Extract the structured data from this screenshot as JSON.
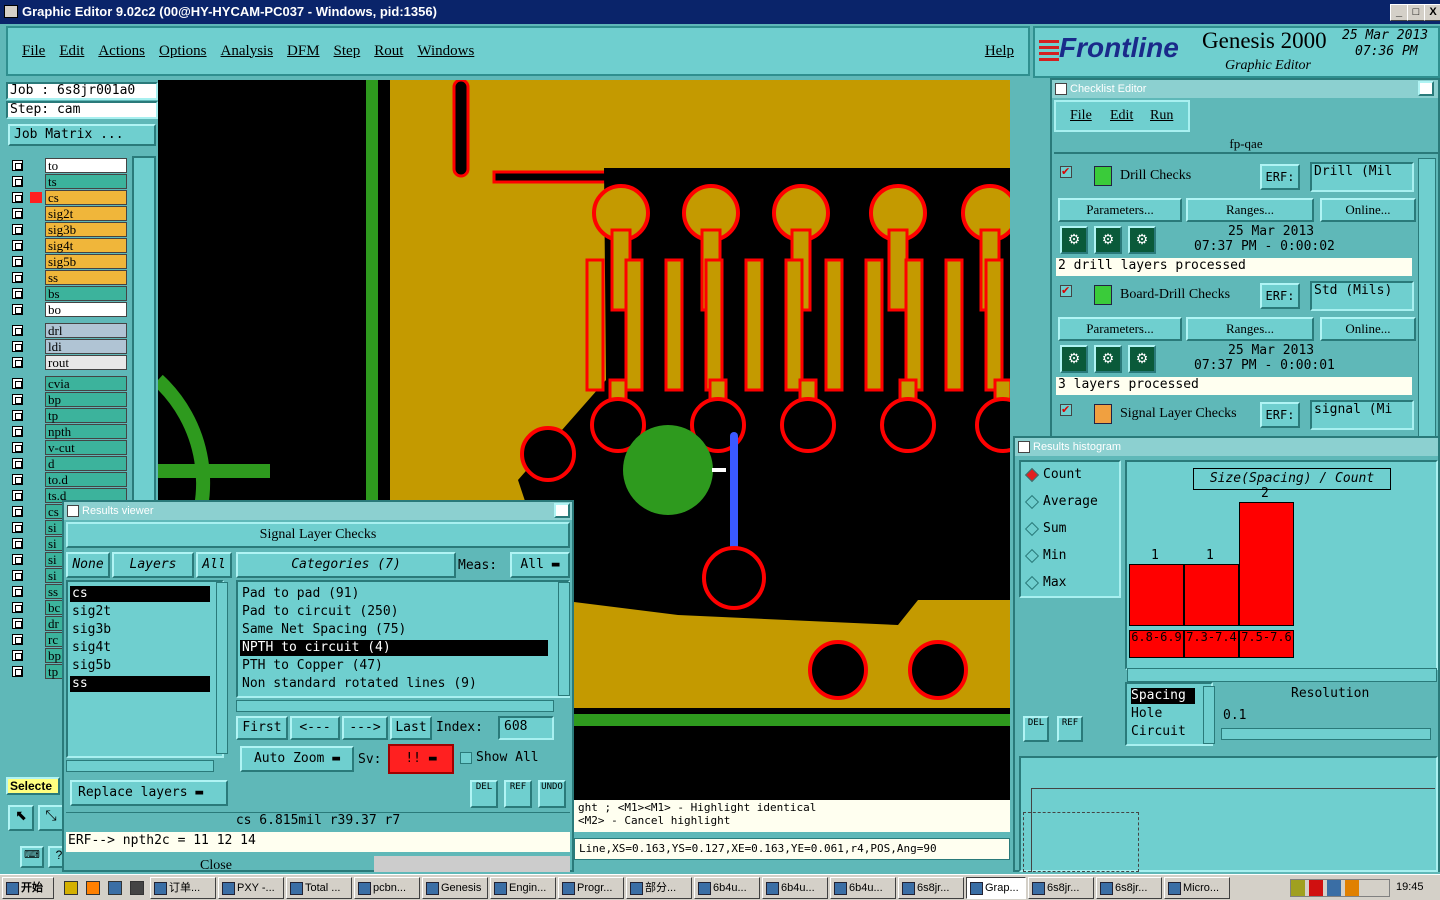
{
  "window": {
    "title": "Graphic Editor 9.02c2 (00@HY-HYCAM-PC037 - Windows, pid:1356)",
    "btns": [
      "_",
      "□",
      "X"
    ]
  },
  "menu": [
    "File",
    "Edit",
    "Actions",
    "Options",
    "Analysis",
    "DFM",
    "Step",
    "Rout",
    "Windows"
  ],
  "help": "Help",
  "brand": {
    "name": "Frontline",
    "product": "Genesis 2000",
    "sub": "Graphic Editor",
    "date": "25 Mar 2013",
    "time": "07:36 PM"
  },
  "job": {
    "job": "Job  :  6s8jr001a0",
    "step": "Step: cam",
    "matrix": "Job Matrix ..."
  },
  "layers_a": [
    "to",
    "ts",
    "cs",
    "sig2t",
    "sig3b",
    "sig4t",
    "sig5b",
    "ss",
    "bs",
    "bo"
  ],
  "layers_b": [
    "drl",
    "ldi",
    "rout"
  ],
  "layers_c": [
    "cvia",
    "bp",
    "tp",
    "npth",
    "v-cut",
    "d",
    "to.d",
    "ts.d",
    "cs",
    "si",
    "si",
    "si",
    "si",
    "ss",
    "bc",
    "dr",
    "rc",
    "bp",
    "tp"
  ],
  "select_label": "Selecte",
  "checklist": {
    "title": "Checklist Editor",
    "menu": [
      "File",
      "Edit",
      "Run"
    ],
    "name": "fp-qae",
    "checks": [
      {
        "name": "Drill Checks",
        "erf": "ERF:",
        "erfval": "Drill (Mil",
        "params": "Parameters...",
        "ranges": "Ranges...",
        "online": "Online...",
        "date": "25 Mar 2013",
        "time": "07:37 PM - 0:00:02",
        "status": "2 drill layers processed"
      },
      {
        "name": "Board-Drill Checks",
        "erf": "ERF:",
        "erfval": "Std (Mils)",
        "params": "Parameters...",
        "ranges": "Ranges...",
        "online": "Online...",
        "date": "25 Mar 2013",
        "time": "07:37 PM - 0:00:01",
        "status": "3 layers processed"
      },
      {
        "name": "Signal Layer Checks",
        "erf": "ERF:",
        "erfval": "signal (Mi"
      }
    ]
  },
  "histogram": {
    "title": "Results histogram",
    "modes": [
      "Count",
      "Average",
      "Sum",
      "Min",
      "Max"
    ],
    "chart_title": "Size(Spacing) / Count",
    "del": "DEL",
    "ref": "REF",
    "list": [
      "Spacing",
      "Hole",
      "Circuit"
    ],
    "resolution_label": "Resolution",
    "resolution": "0.1",
    "chart_data": {
      "type": "bar",
      "categories": [
        "6.8-6.9",
        "7.3-7.4",
        "7.5-7.6"
      ],
      "values": [
        1,
        1,
        2
      ],
      "title": "Size(Spacing) / Count"
    }
  },
  "results": {
    "title": "Results viewer",
    "heading": "Signal Layer Checks",
    "none": "None",
    "layers": "Layers",
    "all": "All",
    "categories_btn": "Categories (7)",
    "meas": "Meas:",
    "meas_val": "All",
    "layer_list": [
      "cs",
      "sig2t",
      "sig3b",
      "sig4t",
      "sig5b",
      "ss"
    ],
    "cat_list": [
      "Pad to pad (91)",
      "Pad to circuit (250)",
      "Same Net Spacing (75)",
      "NPTH to circuit (4)",
      "PTH to Copper (47)",
      "Non standard rotated lines (9)"
    ],
    "first": "First",
    "prev": "<---",
    "next": "--->",
    "last": "Last",
    "index_label": "Index:",
    "index_val": "608",
    "autozoom": "Auto Zoom",
    "sv": "Sv:",
    "sv_val": "!!",
    "showall": "Show All",
    "replace": "Replace layers",
    "del": "DEL",
    "ref": "REF",
    "undo": "UNDO",
    "info": "cs 6.815mil  r39.37  r7",
    "erf": "ERF--> npth2c = 11 12 14",
    "close": "Close"
  },
  "hint": {
    "l1": "ght ; <M1><M1> - Highlight identical",
    "l2": "<M2> - Cancel highlight"
  },
  "coords": "Line,XS=0.163,YS=0.127,XE=0.163,YE=0.061,r4,POS,Ang=90",
  "taskbar": {
    "start": "开始",
    "items": [
      "订单...",
      "PXY -...",
      "Total ...",
      "pcbn...",
      "Genesis",
      "Engin...",
      "Progr...",
      "部分...",
      "6b4u...",
      "6b4u...",
      "6b4u...",
      "6s8jr...",
      "Grap...",
      "6s8jr...",
      "6s8jr...",
      "Micro..."
    ],
    "clock": "19:45"
  }
}
